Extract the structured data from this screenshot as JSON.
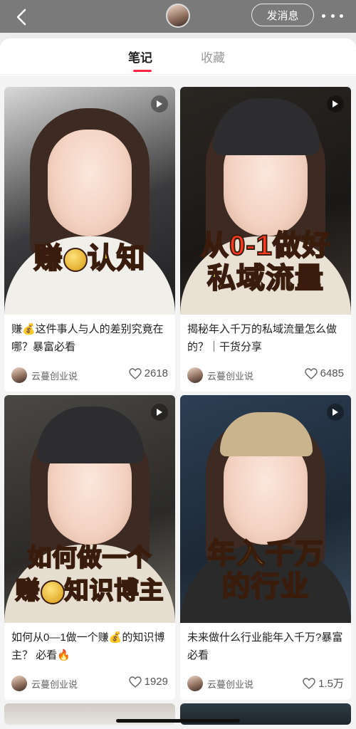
{
  "header": {
    "message_button": "发消息"
  },
  "tabs": [
    {
      "label": "笔记"
    },
    {
      "label": "收藏"
    }
  ],
  "cards": [
    {
      "overlay_line1": "赚",
      "overlay_line1b": "认知",
      "desc": "赚💰这件事人与人的差别究竟在哪？暴富必看",
      "author": "云蔓创业说",
      "likes": "2618"
    },
    {
      "overlay_line1": "从0-1做好",
      "overlay_line2": "私域流量",
      "desc": "揭秘年入千万的私域流量怎么做的？｜干货分享",
      "author": "云蔓创业说",
      "likes": "6485"
    },
    {
      "overlay_line1": "如何做一个",
      "overlay_line2a": "赚",
      "overlay_line2b": "知识博主",
      "desc": "如何从0—1做一个赚💰的知识博主？ 必看🔥",
      "author": "云蔓创业说",
      "likes": "1929"
    },
    {
      "overlay_line1": "年入千万",
      "overlay_line2": "的行业",
      "desc": "未来做什么行业能年入千万?暴富必看",
      "author": "云蔓创业说",
      "likes": "1.5万"
    }
  ],
  "colors": {
    "accent": "#ff2442",
    "overlay_yellow": "#ffe23a",
    "overlay_red": "#ff3a1e"
  }
}
